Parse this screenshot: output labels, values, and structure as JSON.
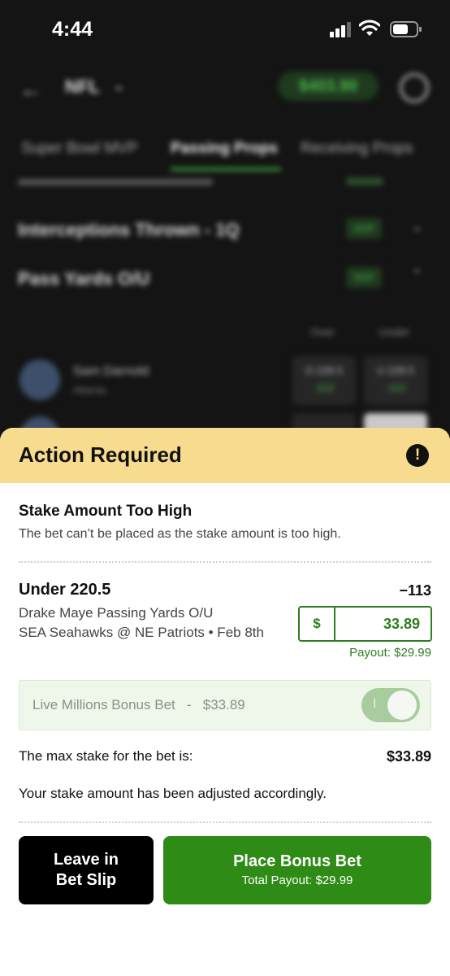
{
  "status_bar": {
    "time": "4:44"
  },
  "background": {
    "league": "NFL",
    "balance": "$403.90",
    "tabs": [
      "Super Bowl MVP",
      "Passing Props",
      "Receiving Props"
    ],
    "markets": [
      {
        "title": "Interceptions Thrown - 1Q",
        "badge": "SGP"
      },
      {
        "title": "Pass Yards O/U",
        "badge": "SGP"
      }
    ],
    "column_headers": [
      "Over",
      "Under"
    ],
    "players": [
      {
        "name": "Sam Darnold",
        "team": "Atlanta",
        "over": "O 228.5",
        "over_price": "-112",
        "under": "U 228.5",
        "under_price": "-112"
      }
    ]
  },
  "sheet": {
    "title": "Action Required",
    "alert_icon": "!",
    "error_title": "Stake Amount Too High",
    "error_description": "The bet can’t be placed as the stake amount is too high.",
    "bet": {
      "selection": "Under 220.5",
      "odds": "−113",
      "market": "Drake Maye Passing Yards O/U",
      "event": "SEA Seahawks @ NE Patriots • Feb 8th",
      "currency_symbol": "$",
      "stake": "33.89",
      "payout": "Payout: $29.99"
    },
    "bonus": {
      "label": "Live Millions Bonus Bet   -   $33.89",
      "toggle_mark": "I",
      "enabled": true
    },
    "max_stake_label": "The max stake for the bet is:",
    "max_stake_value": "$33.89",
    "adjusted_message": "Your stake amount has been adjusted accordingly.",
    "leave_button_line1": "Leave in",
    "leave_button_line2": "Bet Slip",
    "place_button_label": "Place Bonus Bet",
    "place_button_sub": "Total Payout: $29.99"
  },
  "colors": {
    "header_bg": "#f7dc8f",
    "accent_green": "#2e8b16",
    "stake_green": "#2e7d1e",
    "bonus_bg": "#eef7ea"
  }
}
